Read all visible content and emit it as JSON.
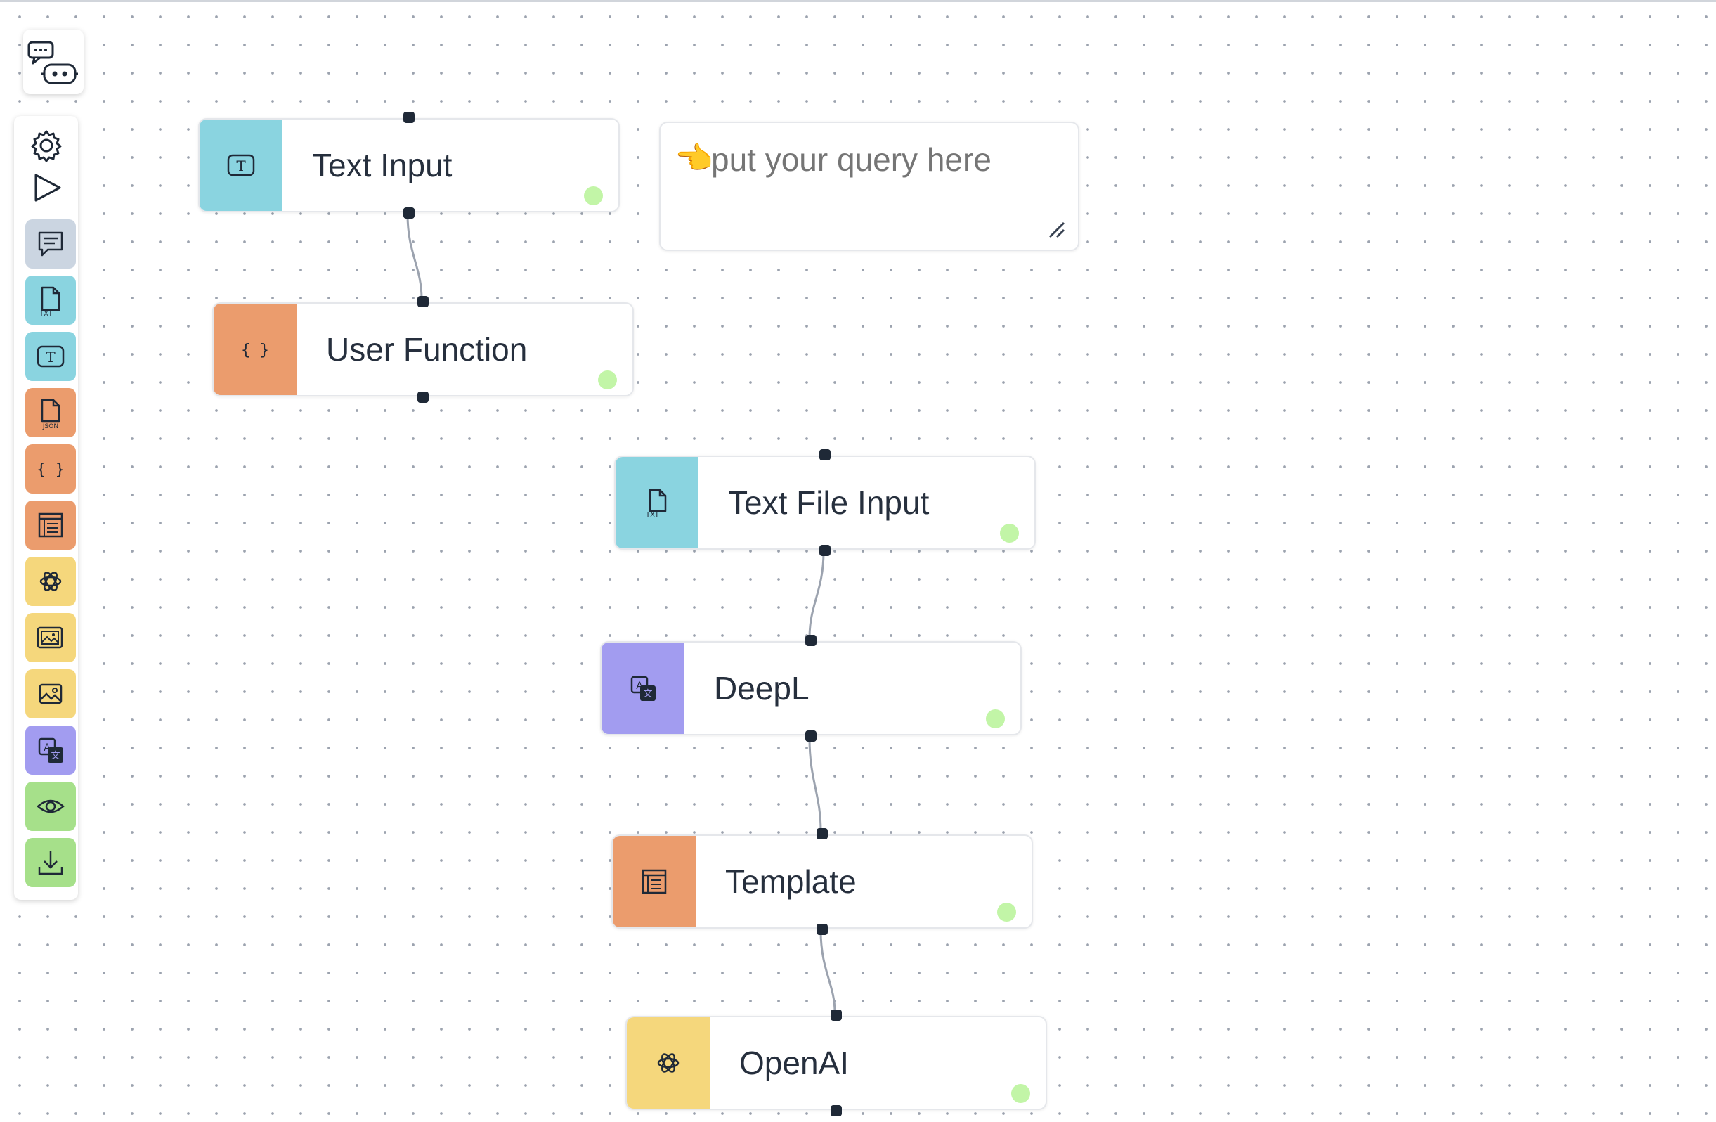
{
  "app": {
    "logo_icon": "chat-bot-icon"
  },
  "sidebar": {
    "tools": [
      {
        "name": "settings",
        "icon": "gear-icon"
      },
      {
        "name": "run",
        "icon": "play-icon"
      }
    ],
    "palette": [
      {
        "name": "comment",
        "icon": "comment-icon",
        "color": "#cbd5e1"
      },
      {
        "name": "text-file-input",
        "icon": "txt-file-icon",
        "color": "#8ad4e0",
        "icon_text": "TXT"
      },
      {
        "name": "text-input",
        "icon": "text-input-icon",
        "color": "#8ad4e0",
        "icon_text": "T"
      },
      {
        "name": "json-file",
        "icon": "json-file-icon",
        "color": "#eb9c6d",
        "icon_text": "JSON"
      },
      {
        "name": "user-function",
        "icon": "braces-icon",
        "color": "#eb9c6d",
        "icon_text": "{ }"
      },
      {
        "name": "template",
        "icon": "template-icon",
        "color": "#eb9c6d"
      },
      {
        "name": "openai",
        "icon": "openai-icon",
        "color": "#f5d77c"
      },
      {
        "name": "image-generate",
        "icon": "image-stack-icon",
        "color": "#f5d77c"
      },
      {
        "name": "image",
        "icon": "image-icon",
        "color": "#f5d77c"
      },
      {
        "name": "deepl",
        "icon": "translate-icon",
        "color": "#a29cf0"
      },
      {
        "name": "preview",
        "icon": "eye-icon",
        "color": "#a6e08a"
      },
      {
        "name": "download",
        "icon": "download-icon",
        "color": "#a6e08a"
      }
    ]
  },
  "nodes": {
    "text_input": {
      "label": "Text Input",
      "icon": "text-input-icon",
      "icon_text": "T",
      "color": "#8ad4e0"
    },
    "user_function": {
      "label": "User Function",
      "icon": "braces-icon",
      "icon_text": "{ }",
      "color": "#eb9c6d"
    },
    "text_file_input": {
      "label": "Text File Input",
      "icon": "txt-file-icon",
      "icon_text": "TXT",
      "color": "#8ad4e0"
    },
    "deepl": {
      "label": "DeepL",
      "icon": "translate-icon",
      "icon_text": "A",
      "color": "#a29cf0"
    },
    "template": {
      "label": "Template",
      "icon": "template-icon",
      "color": "#eb9c6d"
    },
    "openai": {
      "label": "OpenAI",
      "icon": "openai-icon",
      "color": "#f5d77c"
    }
  },
  "note": {
    "emoji": "👈",
    "placeholder": "put your query here"
  },
  "colors": {
    "status_ok": "#c2f5a7",
    "handle": "#1f2937",
    "edge": "#9ca3af"
  }
}
